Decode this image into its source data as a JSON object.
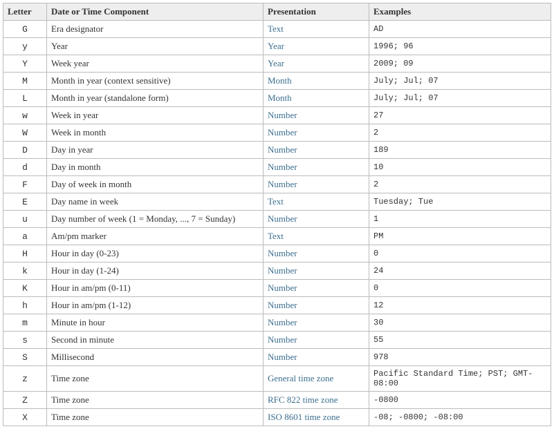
{
  "headers": {
    "letter": "Letter",
    "component": "Date or Time Component",
    "presentation": "Presentation",
    "examples": "Examples"
  },
  "rows": [
    {
      "letter": "G",
      "component": "Era designator",
      "presentation": "Text",
      "examples": "AD"
    },
    {
      "letter": "y",
      "component": "Year",
      "presentation": "Year",
      "examples": "1996; 96"
    },
    {
      "letter": "Y",
      "component": "Week year",
      "presentation": "Year",
      "examples": "2009; 09"
    },
    {
      "letter": "M",
      "component": "Month in year (context sensitive)",
      "presentation": "Month",
      "examples": "July; Jul; 07"
    },
    {
      "letter": "L",
      "component": "Month in year (standalone form)",
      "presentation": "Month",
      "examples": "July; Jul; 07"
    },
    {
      "letter": "w",
      "component": "Week in year",
      "presentation": "Number",
      "examples": "27"
    },
    {
      "letter": "W",
      "component": "Week in month",
      "presentation": "Number",
      "examples": "2"
    },
    {
      "letter": "D",
      "component": "Day in year",
      "presentation": "Number",
      "examples": "189"
    },
    {
      "letter": "d",
      "component": "Day in month",
      "presentation": "Number",
      "examples": "10"
    },
    {
      "letter": "F",
      "component": "Day of week in month",
      "presentation": "Number",
      "examples": "2"
    },
    {
      "letter": "E",
      "component": "Day name in week",
      "presentation": "Text",
      "examples": "Tuesday; Tue"
    },
    {
      "letter": "u",
      "component": "Day number of week (1 = Monday, ..., 7 = Sunday)",
      "presentation": "Number",
      "examples": "1"
    },
    {
      "letter": "a",
      "component": "Am/pm marker",
      "presentation": "Text",
      "examples": "PM"
    },
    {
      "letter": "H",
      "component": "Hour in day (0-23)",
      "presentation": "Number",
      "examples": "0"
    },
    {
      "letter": "k",
      "component": "Hour in day (1-24)",
      "presentation": "Number",
      "examples": "24"
    },
    {
      "letter": "K",
      "component": "Hour in am/pm (0-11)",
      "presentation": "Number",
      "examples": "0"
    },
    {
      "letter": "h",
      "component": "Hour in am/pm (1-12)",
      "presentation": "Number",
      "examples": "12"
    },
    {
      "letter": "m",
      "component": "Minute in hour",
      "presentation": "Number",
      "examples": "30"
    },
    {
      "letter": "s",
      "component": "Second in minute",
      "presentation": "Number",
      "examples": "55"
    },
    {
      "letter": "S",
      "component": "Millisecond",
      "presentation": "Number",
      "examples": "978"
    },
    {
      "letter": "z",
      "component": "Time zone",
      "presentation": "General time zone",
      "examples": "Pacific Standard Time; PST; GMT-08:00"
    },
    {
      "letter": "Z",
      "component": "Time zone",
      "presentation": "RFC 822 time zone",
      "examples": "-0800"
    },
    {
      "letter": "X",
      "component": "Time zone",
      "presentation": "ISO 8601 time zone",
      "examples": "-08; -0800; -08:00"
    }
  ]
}
